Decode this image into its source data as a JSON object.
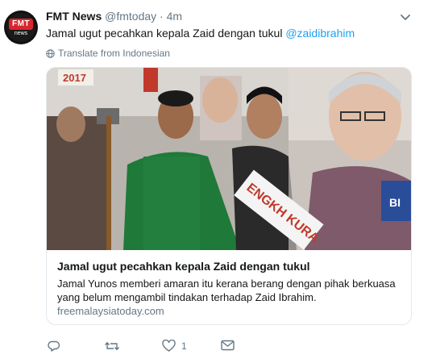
{
  "tweet": {
    "author_name": "FMT News",
    "author_handle": "@fmtoday",
    "separator": "·",
    "time": "4m",
    "text": "Jamal ugut pecahkan kepala Zaid dengan tukul",
    "mention": "@zaidibrahim",
    "translate_label": "Translate from Indonesian",
    "avatar_logo": "FMT",
    "avatar_sub": "news"
  },
  "card": {
    "title": "Jamal ugut pecahkan kepala Zaid dengan tukul",
    "description": "Jamal Yunos memberi amaran itu kerana berang dengan pihak berkuasa yang belum mengambil tindakan terhadap Zaid Ibrahim.",
    "domain": "freemalaysiatoday.com",
    "photo_sign_text": "2017",
    "photo_banner_text": "ENGKH KURA",
    "photo_banner_text2": "BI"
  },
  "actions": {
    "reply_count": "",
    "retweet_count": "",
    "like_count": "1",
    "dm_count": ""
  },
  "colors": {
    "link": "#1da1f2",
    "muted": "#657786",
    "border": "#e1e8ed",
    "avatar_red": "#d7262e"
  },
  "icons": [
    "chevron-down-icon",
    "globe-icon",
    "reply-icon",
    "retweet-icon",
    "heart-icon",
    "envelope-icon"
  ]
}
